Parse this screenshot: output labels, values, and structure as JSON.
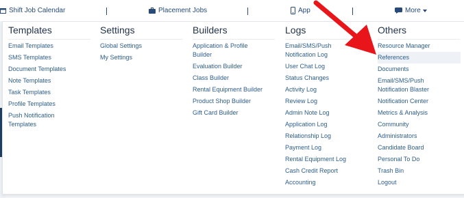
{
  "topbar": {
    "items": [
      {
        "label": "Shift Job Calendar",
        "icon": "calendar-icon"
      },
      {
        "label": "Placement Jobs",
        "icon": "briefcase-icon"
      },
      {
        "label": "App",
        "icon": "mobile-icon"
      },
      {
        "label": "More",
        "icon": "chat-icon"
      }
    ]
  },
  "menu": {
    "columns": [
      {
        "title": "Templates",
        "items": [
          "Email Templates",
          "SMS Templates",
          "Document Templates",
          "Note Templates",
          "Task Templates",
          "Profile Templates",
          "Push Notification Templates"
        ]
      },
      {
        "title": "Settings",
        "items": [
          "Global Settings",
          "My Settings"
        ]
      },
      {
        "title": "Builders",
        "items": [
          "Application & Profile Builder",
          "Evaluation Builder",
          "Class Builder",
          "Rental Equipment Builder",
          "Product Shop Builder",
          "Gift Card Builder"
        ]
      },
      {
        "title": "Logs",
        "items": [
          "Email/SMS/Push Notification Log",
          "User Chat Log",
          "Status Changes",
          "Activity Log",
          "Review Log",
          "Admin Note Log",
          "Application Log",
          "Relationship Log",
          "Payment Log",
          "Rental Equipment Log",
          "Cash Credit Report",
          "Accounting"
        ]
      },
      {
        "title": "Others",
        "items": [
          "Resource Manager",
          "References",
          "Documents",
          "Email/SMS/Push Notification Blaster",
          "Notification Center",
          "Metrics & Analysis",
          "Community",
          "Administrators",
          "Candidate Board",
          "Personal To Do",
          "Trash Bin",
          "Logout"
        ]
      }
    ],
    "highlighted": "References"
  },
  "colors": {
    "link": "#2d5d8c",
    "heading": "#23334a",
    "nav": "#274a7a",
    "arrow": "#e8161b"
  }
}
